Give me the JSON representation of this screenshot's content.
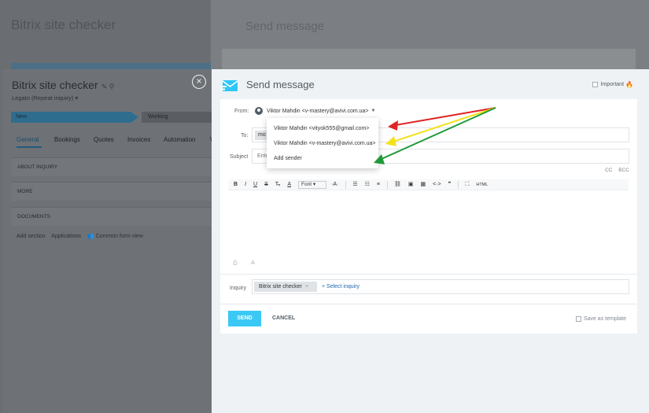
{
  "left_panel": {
    "title": "Bitrix site checker",
    "subtitle": "Legato (Repeat inquiry)",
    "stages": [
      "New",
      "Working"
    ],
    "tabs": [
      "General",
      "Bookings",
      "Quotes",
      "Invoices",
      "Automation",
      "W"
    ],
    "sections": [
      "ABOUT INQUIRY",
      "MORE",
      "DOCUMENTS"
    ],
    "footer_links": [
      "Add section",
      "Applications",
      "Common form view"
    ]
  },
  "slider": {
    "title": "Send message",
    "important_label": "Important",
    "from_label": "From:",
    "from_value": "Viktor Mahdin <v-mastery@avivi.com.ua>",
    "to_label": "To:",
    "to_chip": "mo",
    "subject_label": "Subject",
    "subject_placeholder": "Ente",
    "cc": "CC",
    "bcc": "BCC",
    "toolbar": {
      "font": "Font",
      "html": "HTML"
    },
    "inquiry_label": "Inquiry",
    "inquiry_chip": "Bitrix site checker",
    "select_inquiry": "+ Select inquiry",
    "send": "SEND",
    "cancel": "CANCEL",
    "save_template": "Save as template"
  },
  "dropdown": {
    "items": [
      "Viktor Mahdin <vityok555@gmail.com>",
      "Viktor Mahdin <v-mastery@avivi.com.ua>",
      "Add sender"
    ]
  },
  "colors": {
    "accent": "#3bc8f5",
    "link": "#2067b0",
    "arrow_red": "#e02424",
    "arrow_yellow": "#f4e21b",
    "arrow_green": "#1f9a3a"
  }
}
